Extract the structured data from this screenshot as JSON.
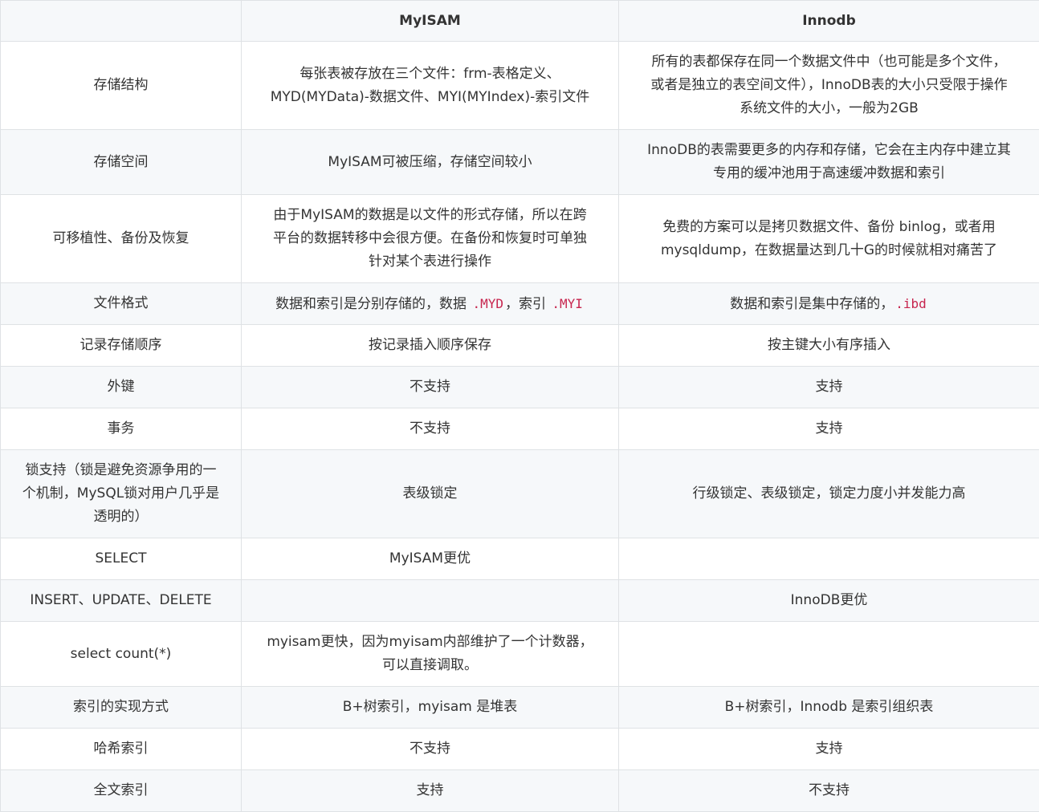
{
  "header": {
    "feature": "",
    "myisam": "MyISAM",
    "innodb": "Innodb"
  },
  "rows": [
    {
      "feature": [
        "存储结构"
      ],
      "myisam": [
        "每张表被存放在三个文件：frm-表格定义、",
        "MYD(MYData)-数据文件、MYI(MYIndex)-索引文件"
      ],
      "innodb": [
        "所有的表都保存在同一个数据文件中（也可能是多个文件，",
        "或者是独立的表空间文件），InnoDB表的大小只受限于操作",
        "系统文件的大小，一般为2GB"
      ]
    },
    {
      "feature": [
        "存储空间"
      ],
      "myisam": [
        "MyISAM可被压缩，存储空间较小"
      ],
      "innodb": [
        "InnoDB的表需要更多的内存和存储，它会在主内存中建立其",
        "专用的缓冲池用于高速缓冲数据和索引"
      ]
    },
    {
      "feature": [
        "可移植性、备份及恢复"
      ],
      "myisam": [
        "由于MyISAM的数据是以文件的形式存储，所以在跨",
        "平台的数据转移中会很方便。在备份和恢复时可单独",
        "针对某个表进行操作"
      ],
      "innodb": [
        "免费的方案可以是拷贝数据文件、备份 binlog，或者用",
        "mysqldump，在数据量达到几十G的时候就相对痛苦了"
      ]
    },
    {
      "feature": [
        "文件格式"
      ],
      "myisam_parts": {
        "t1": "数据和索引是分别存储的，数据 ",
        "c1": ".MYD",
        "t2": "，索引 ",
        "c2": ".MYI"
      },
      "innodb_parts": {
        "t1": "数据和索引是集中存储的，",
        "c1": ".ibd"
      }
    },
    {
      "feature": [
        "记录存储顺序"
      ],
      "myisam": [
        "按记录插入顺序保存"
      ],
      "innodb": [
        "按主键大小有序插入"
      ]
    },
    {
      "feature": [
        "外键"
      ],
      "myisam": [
        "不支持"
      ],
      "innodb": [
        "支持"
      ]
    },
    {
      "feature": [
        "事务"
      ],
      "myisam": [
        "不支持"
      ],
      "innodb": [
        "支持"
      ]
    },
    {
      "feature": [
        "锁支持（锁是避免资源争用的一",
        "个机制，MySQL锁对用户几乎是",
        "透明的）"
      ],
      "myisam": [
        "表级锁定"
      ],
      "innodb": [
        "行级锁定、表级锁定，锁定力度小并发能力高"
      ]
    },
    {
      "feature": [
        "SELECT"
      ],
      "myisam": [
        "MyISAM更优"
      ],
      "innodb": []
    },
    {
      "feature": [
        "INSERT、UPDATE、DELETE"
      ],
      "myisam": [],
      "innodb": [
        "InnoDB更优"
      ]
    },
    {
      "feature": [
        "select count(*)"
      ],
      "myisam": [
        "myisam更快，因为myisam内部维护了一个计数器，",
        "可以直接调取。"
      ],
      "innodb": []
    },
    {
      "feature": [
        "索引的实现方式"
      ],
      "myisam": [
        "B+树索引，myisam 是堆表"
      ],
      "innodb": [
        "B+树索引，Innodb 是索引组织表"
      ]
    },
    {
      "feature": [
        "哈希索引"
      ],
      "myisam": [
        "不支持"
      ],
      "innodb": [
        "支持"
      ]
    },
    {
      "feature": [
        "全文索引"
      ],
      "myisam": [
        "支持"
      ],
      "innodb": [
        "不支持"
      ]
    }
  ]
}
